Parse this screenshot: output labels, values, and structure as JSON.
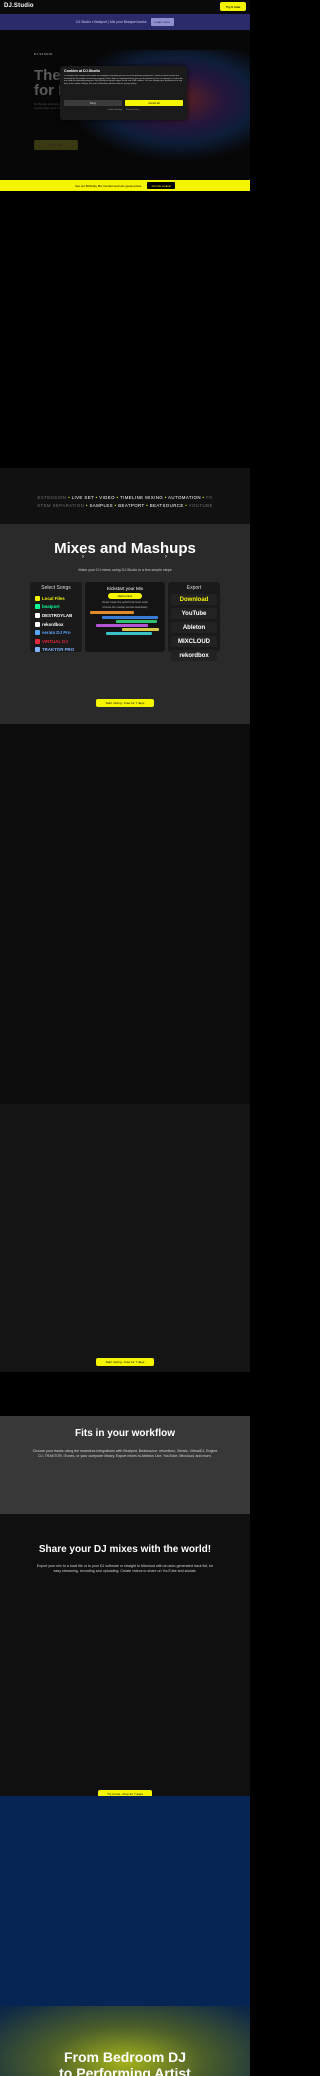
{
  "header": {
    "logo_text": "DJ.Studio",
    "cta_label": "Try it now"
  },
  "announcement": {
    "text": "DJ.Studio x Beatport | Mix your Beatport tracks",
    "button_label": "Learn more"
  },
  "hero": {
    "eyebrow": "DJ.STUDIO",
    "title": "The first DAW for DJs",
    "subtitle": "DJ.Studio is a new kind of DJ software that gives you total control over your mixes using a timeline.",
    "cta_label": "Try it now"
  },
  "cookie": {
    "title": "Cookies at DJ.Studio",
    "body": "DJ.Studio uses cookies and similar technologies to provide you with the best possible experience. Some of these cookies are essential for the website to function properly, others help us understand how you use the website so we can improve it, and some are used for marketing purposes. By clicking accept you agree to the use of all cookies. You can change your preferences at any time in the cookie settings. For more information please read our privacy policy.",
    "deny_label": "Deny",
    "accept_label": "Accept all",
    "links": [
      "Cookie Settings",
      "Privacy Policy"
    ]
  },
  "promo": {
    "text": "Get our Birthday Mix Contest and win great prizes",
    "button_label": "Join the contest"
  },
  "keywords": {
    "row1": [
      {
        "t": "EXTENSION",
        "s": "dim"
      },
      {
        "t": "•",
        "s": "yel"
      },
      {
        "t": "LIVE SET",
        "s": "bright"
      },
      {
        "t": "•",
        "s": "yel"
      },
      {
        "t": "VIDEO",
        "s": "bright"
      },
      {
        "t": "•",
        "s": "yel"
      },
      {
        "t": "TIMELINE MIXING",
        "s": "bright"
      },
      {
        "t": "•",
        "s": "yel"
      },
      {
        "t": "AUTOMATION",
        "s": "bright"
      },
      {
        "t": "•",
        "s": "yel"
      },
      {
        "t": "FX",
        "s": "dim"
      }
    ],
    "row2": [
      {
        "t": "STEM SEPARATION",
        "s": "dim"
      },
      {
        "t": "•",
        "s": "yel"
      },
      {
        "t": "SAMPLES",
        "s": "bright"
      },
      {
        "t": "•",
        "s": "yel"
      },
      {
        "t": "BEATPORT",
        "s": "bright"
      },
      {
        "t": "•",
        "s": "yel"
      },
      {
        "t": "BEATSOURCE",
        "s": "bright"
      },
      {
        "t": "•",
        "s": "yel"
      },
      {
        "t": "YOUTUBE",
        "s": "dim"
      }
    ]
  },
  "mixes": {
    "title": "Mixes and Mashups",
    "subtitle": "Make your DJ mixes using DJ.Studio in a few simple steps",
    "select_heading": "Select Songs",
    "sources": [
      {
        "label": "Local Files",
        "color": "#f5f500"
      },
      {
        "label": "beatport",
        "color": "#01ff95"
      },
      {
        "label": "DESTROYLAB",
        "color": "#ffffff"
      },
      {
        "label": "rekordbox",
        "color": "#ffffff"
      },
      {
        "label": "serato DJ Pro",
        "color": "#5aa5ff"
      },
      {
        "label": "VIRTUAL DJ",
        "color": "#e0283a"
      },
      {
        "label": "TRAKTOR PRO",
        "color": "#7fb3ff"
      }
    ],
    "middle_heading": "Kickstart your Mix",
    "middle_pill": "Harmonize",
    "middle_note": "Smart create the perfect harmonic order",
    "middle_note2": "Choose the overlap sounds seamlessly",
    "export_heading": "Export",
    "exports": [
      {
        "label": "Download",
        "color": "#f5f500"
      },
      {
        "label": "YouTube",
        "color": "#ffffff"
      },
      {
        "label": "Ableton",
        "color": "#ffffff"
      },
      {
        "label": "MIXCLOUD",
        "color": "#ffffff"
      },
      {
        "label": "rekordbox",
        "color": "#ffffff"
      }
    ],
    "cta_label": "Start mixing - Free for 7 days"
  },
  "dark2": {
    "cta_label": "Start mixing - Free for 7 days"
  },
  "workflow": {
    "title": "Fits in your workflow",
    "body": "Choose your tracks using the seamless integrations with Beatport, Beatsource, rekordbox, Serato, VirtualDJ, Engine DJ, TRAKTOR, iTunes, or your computer library. Export mixes to Ableton Live, YouTube, Mixcloud, and more."
  },
  "share": {
    "title": "Share your DJ mixes with the world!",
    "body": "Export your mix to a local file or to your DJ software or straight to Mixcloud with an auto-generated track list, for easy streaming, recording and uploading. Create videos to share on YouTube and socials.",
    "cta_label": "Try it now - Free for 7 days"
  },
  "final": {
    "title_line1": "From Bedroom DJ",
    "title_line2": "to Performing Artist"
  },
  "colors": {
    "accent": "#f5f500",
    "announce_bg": "#2b2a6a",
    "blue_section": "#062454"
  }
}
